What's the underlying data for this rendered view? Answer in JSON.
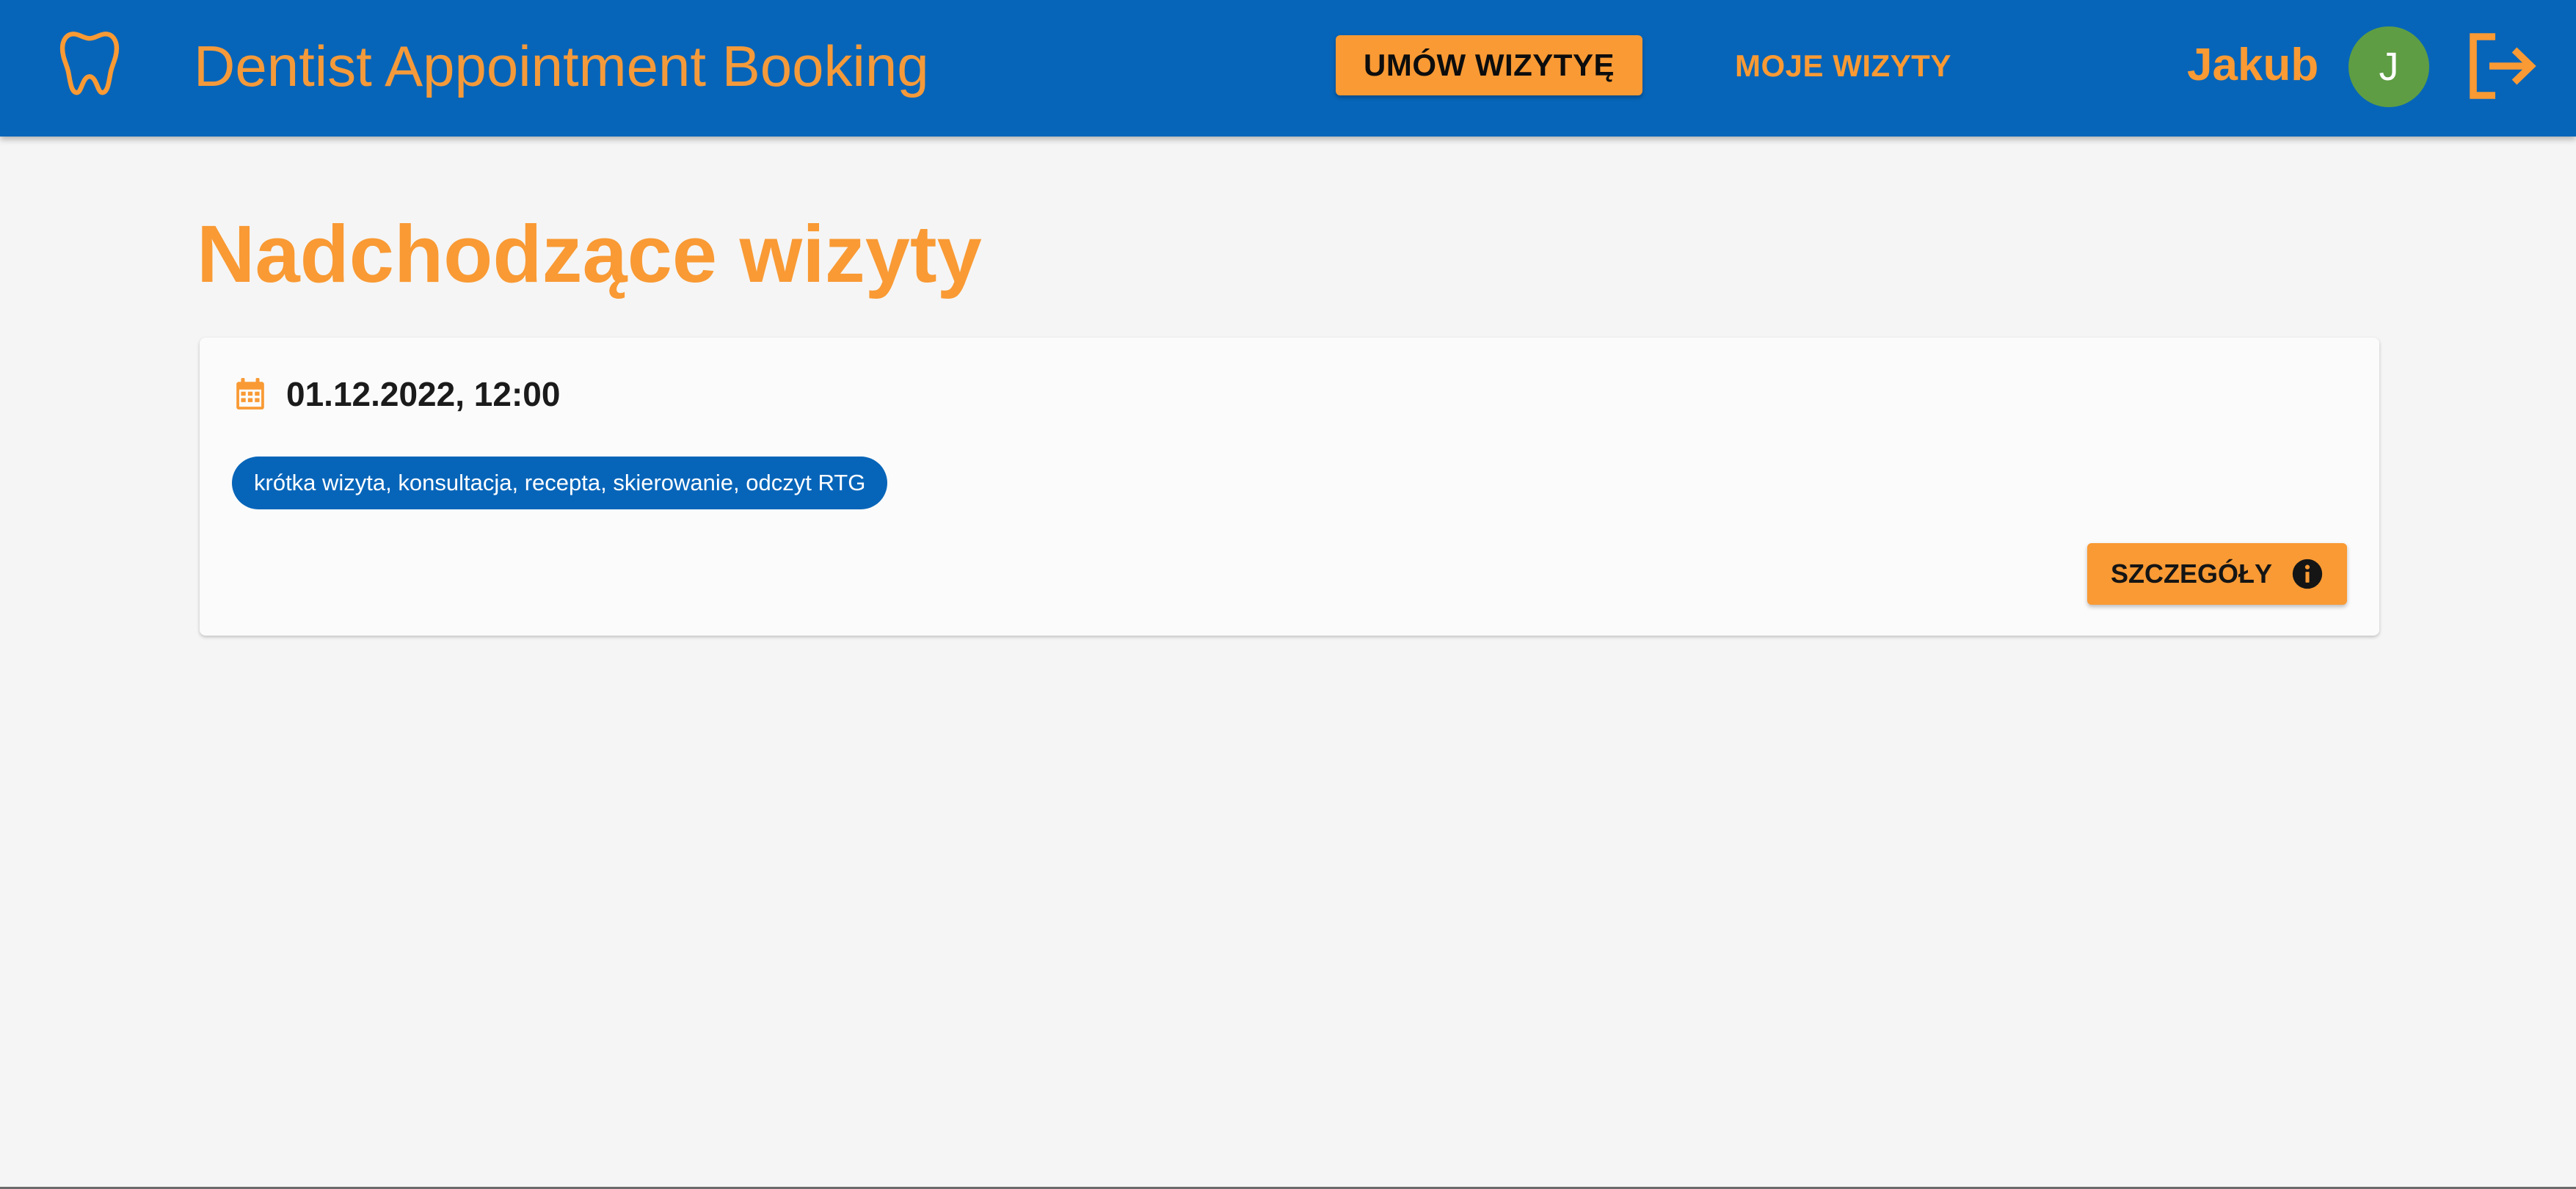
{
  "appbar": {
    "logo_icon": "tooth-icon",
    "title": "Dentist Appointment Booking",
    "book_button_label": "UMÓW WIZYTYĘ",
    "my_visits_label": "MOJE WIZYTY",
    "user_name": "Jakub",
    "avatar_initial": "J",
    "logout_icon": "logout-icon"
  },
  "main": {
    "heading": "Nadchodzące wizyty",
    "appointments": [
      {
        "date_icon": "calendar-icon",
        "datetime": "01.12.2022, 12:00",
        "services": "krótka wizyta, konsultacja, recepta, skierowanie, odczyt RTG",
        "details_button_label": "SZCZEGÓŁY",
        "details_icon": "info-icon"
      }
    ]
  },
  "colors": {
    "primary_blue": "#0765b9",
    "accent_orange": "#f99a34",
    "avatar_green": "#5e9d43",
    "background": "#f5f5f5",
    "card": "#fbfbfb"
  }
}
